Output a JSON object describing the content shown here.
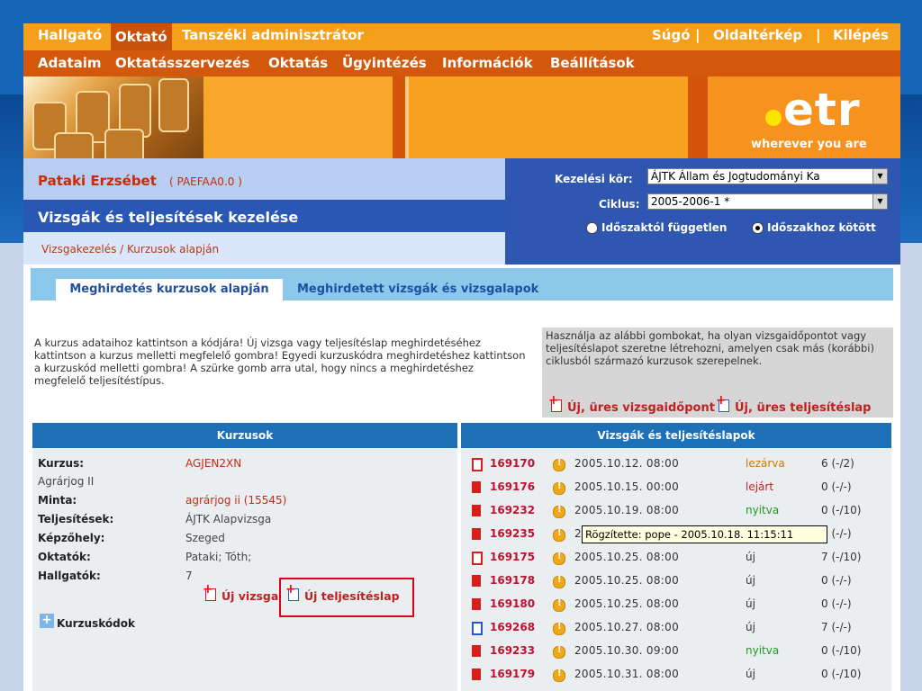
{
  "nav": {
    "roles": [
      "Hallgató",
      "Oktató",
      "Tanszéki adminisztrátor"
    ],
    "active_role": "Oktató",
    "right_links": [
      "Súgó",
      "Oldaltérkép",
      "Kilépés"
    ],
    "menu": [
      "Adataim",
      "Oktatásszervezés",
      "Oktatás",
      "Ügyintézés",
      "Információk",
      "Beállítások"
    ]
  },
  "logo": {
    "brand": "etr",
    "tagline": "wherever you are"
  },
  "user": {
    "name": "Pataki Erzsébet",
    "code": "( PAEFAA0.0 )"
  },
  "page_title": "Vizsgák és teljesítések kezelése",
  "breadcrumb": "Vizsgakezelés / Kurzusok alapján",
  "controls": {
    "kezelesi_kor_label": "Kezelési kör:",
    "kezelesi_kor_value": "ÁJTK Állam és Jogtudományi Ka",
    "ciklus_label": "Ciklus:",
    "ciklus_value": "2005-2006-1 *",
    "radio_independent": "Időszaktól független",
    "radio_bound": "Időszakhoz kötött",
    "selected_radio": "Időszakhoz kötött"
  },
  "tabs": [
    "Meghirdetés kurzusok alapján",
    "Meghirdetett vizsgák és vizsgalapok"
  ],
  "help_text": "A kurzus adataihoz kattintson a kódjára! Új vizsga vagy teljesítéslap meghirdetéséhez kattintson a kurzus melletti megfelelő gombra! Egyedi kurzuskódra meghirdetéshez kattintson a kurzuskód melletti gombra! A szürke gomb arra utal, hogy nincs a meghirdetéshez megfelelő teljesítéstípus.",
  "info_box": {
    "text": "Használja az alábbi gombokat, ha olyan vizsgaidőpontot vagy teljesítéslapot szeretne létrehozni, amelyen csak más (korábbi) ciklusból származó kurzusok szerepelnek.",
    "btn_exam": "Új, üres vizsgaidőpont",
    "btn_sheet": "Új, üres teljesítéslap"
  },
  "left_panel": {
    "header": "Kurzusok",
    "fields": {
      "kurzus_label": "Kurzus:",
      "kurzus_value": "AGJEN2XN",
      "kurzus_name": "Agrárjog II",
      "minta_label": "Minta:",
      "minta_value": "agrárjog ii (15545)",
      "teljesitesek_label": "Teljesítések:",
      "teljesitesek_value": "ÁJTK Alapvizsga",
      "kepzohely_label": "Képzőhely:",
      "kepzohely_value": "Szeged",
      "oktatok_label": "Oktatók:",
      "oktatok_value": "Pataki; Tóth;",
      "hallgatok_label": "Hallgatók:",
      "hallgatok_value": "7"
    },
    "btn_new_exam": "Új vizsga",
    "btn_new_sheet": "Új teljesítéslap",
    "course_codes": "Kurzuskódok"
  },
  "right_panel": {
    "header": "Vizsgák és teljesítéslapok",
    "rows": [
      {
        "id": "169170",
        "date": "2005.10.12. 08:00",
        "status": "lezárva",
        "status_color": "#c87a00",
        "count": "6 (-/2)",
        "icon": "outline-red"
      },
      {
        "id": "169176",
        "date": "2005.10.15. 00:00",
        "status": "lejárt",
        "status_color": "#c41f1f",
        "count": "0 (-/-)",
        "icon": "red"
      },
      {
        "id": "169232",
        "date": "2005.10.19. 08:00",
        "status": "nyitva",
        "status_color": "#1f9a20",
        "count": "0 (-/10)",
        "icon": "red"
      },
      {
        "id": "169235",
        "date": "2",
        "status": "",
        "status_color": "#333",
        "count": "0 (-/-)",
        "icon": "red"
      },
      {
        "id": "169175",
        "date": "2005.10.25. 08:00",
        "status": "új",
        "status_color": "#333",
        "count": "7 (-/10)",
        "icon": "outline-red"
      },
      {
        "id": "169178",
        "date": "2005.10.25. 08:00",
        "status": "új",
        "status_color": "#333",
        "count": "0 (-/-)",
        "icon": "red"
      },
      {
        "id": "169180",
        "date": "2005.10.25. 08:00",
        "status": "új",
        "status_color": "#333",
        "count": "0 (-/-)",
        "icon": "red"
      },
      {
        "id": "169268",
        "date": "2005.10.27. 08:00",
        "status": "új",
        "status_color": "#333",
        "count": "7 (-/-)",
        "icon": "outline-blue"
      },
      {
        "id": "169233",
        "date": "2005.10.30. 09:00",
        "status": "nyitva",
        "status_color": "#1f9a20",
        "count": "0 (-/10)",
        "icon": "red"
      },
      {
        "id": "169179",
        "date": "2005.10.31. 08:00",
        "status": "új",
        "status_color": "#333",
        "count": "0 (-/10)",
        "icon": "red"
      }
    ]
  },
  "tooltip": "Rögzítette: pope - 2005.10.18. 11:15:11",
  "colors": {
    "accent_orange": "#f5a01a",
    "dark_orange": "#d4580b",
    "nav_blue": "#2a56b5",
    "header_blue": "#1d6fb6",
    "link_red": "#c21f1f"
  }
}
